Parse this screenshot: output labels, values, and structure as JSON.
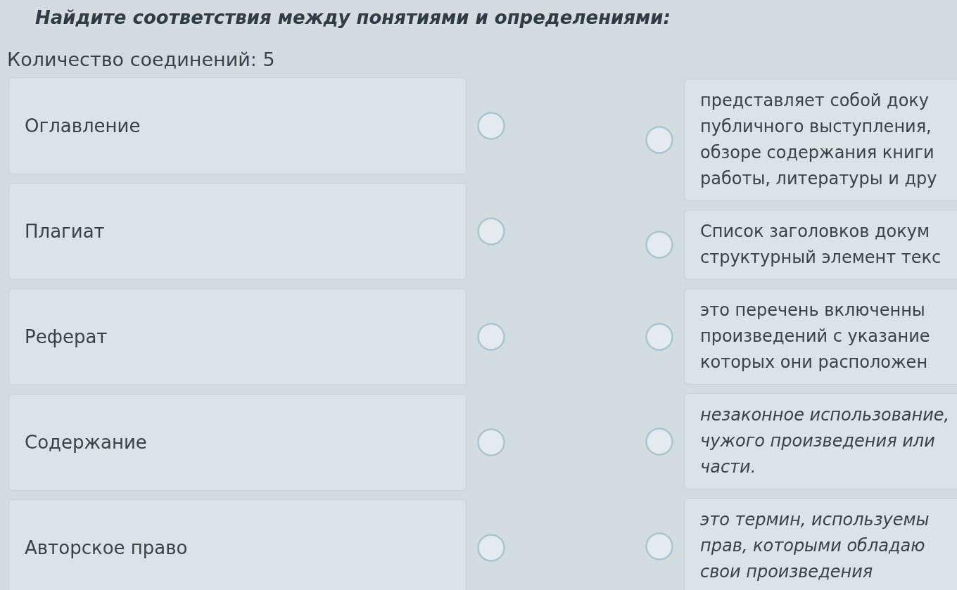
{
  "instruction": {
    "text": "Найдите соответствия между понятиями и определениями:"
  },
  "connection_count": {
    "text": "Количество соединений: 5"
  },
  "terms": [
    {
      "text": "Оглавление"
    },
    {
      "text": "Плагиат"
    },
    {
      "text": "Реферат"
    },
    {
      "text": "Содержание"
    },
    {
      "text": "Авторское право"
    }
  ],
  "definitions": [
    {
      "text": "представляет собой доку\nпубличного выступления,\nобзоре содержания книги\nработы, литературы и дру",
      "italic": false
    },
    {
      "text": "Список заголовков докум\nструктурный элемент текс",
      "italic": false
    },
    {
      "text": "это перечень включенны\nпроизведений с указание\nкоторых они расположен",
      "italic": false
    },
    {
      "text": "незаконное использование,\nчужого произведения или\nчасти.",
      "italic": true
    },
    {
      "text": "это термин, используемы\nправ, которыми обладаю\nсвои произведения",
      "italic": true
    }
  ]
}
